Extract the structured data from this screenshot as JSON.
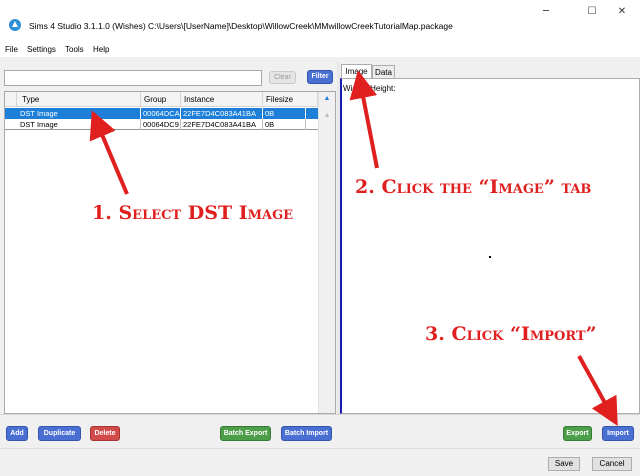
{
  "window": {
    "title": "Sims 4 Studio 3.1.1.0 (Wishes)  C:\\Users\\[UserName]\\Desktop\\WillowCreek\\MMwillowCreekTutorialMap.package",
    "minimize": "─",
    "maximize": "☐",
    "close": "✕"
  },
  "menu": [
    "File",
    "Settings",
    "Tools",
    "Help"
  ],
  "search": {
    "value": "",
    "clear_label": "Clear",
    "filter_label": "Filter"
  },
  "grid": {
    "columns": [
      "Type",
      "Group",
      "Instance",
      "Filesize"
    ],
    "rows": [
      {
        "type": "DST Image",
        "group": "00064DCA",
        "instance": "22FE7D4C083A41BA",
        "filesize": "0B",
        "selected": true
      },
      {
        "type": "DST Image",
        "group": "00064DC9",
        "instance": "22FE7D4C083A41BA",
        "filesize": "0B",
        "selected": false
      }
    ]
  },
  "tabs": [
    {
      "label": "Image",
      "active": true
    },
    {
      "label": "Data",
      "active": false
    }
  ],
  "image_info": {
    "width_label": "Width:",
    "height_label": "Height:"
  },
  "actions": {
    "add": "Add",
    "duplicate": "Duplicate",
    "delete": "Delete",
    "batch_export": "Batch Export",
    "batch_import": "Batch Import",
    "export": "Export",
    "import": "Import"
  },
  "footer": {
    "save": "Save",
    "cancel": "Cancel"
  },
  "annotations": {
    "step1": "1. Select DST Image",
    "step2": "2. Click the “Image” tab",
    "step3": "3. Click “Import”"
  },
  "colors": {
    "selection": "#1e7fd8",
    "button_blue": "#4a6fd3",
    "button_red": "#d24b4b",
    "button_green": "#4c9e48",
    "annotation_red": "#e01f1f"
  },
  "icons": {
    "app": "sims-studio-logo-icon",
    "arrow": "red-arrow-icon"
  }
}
